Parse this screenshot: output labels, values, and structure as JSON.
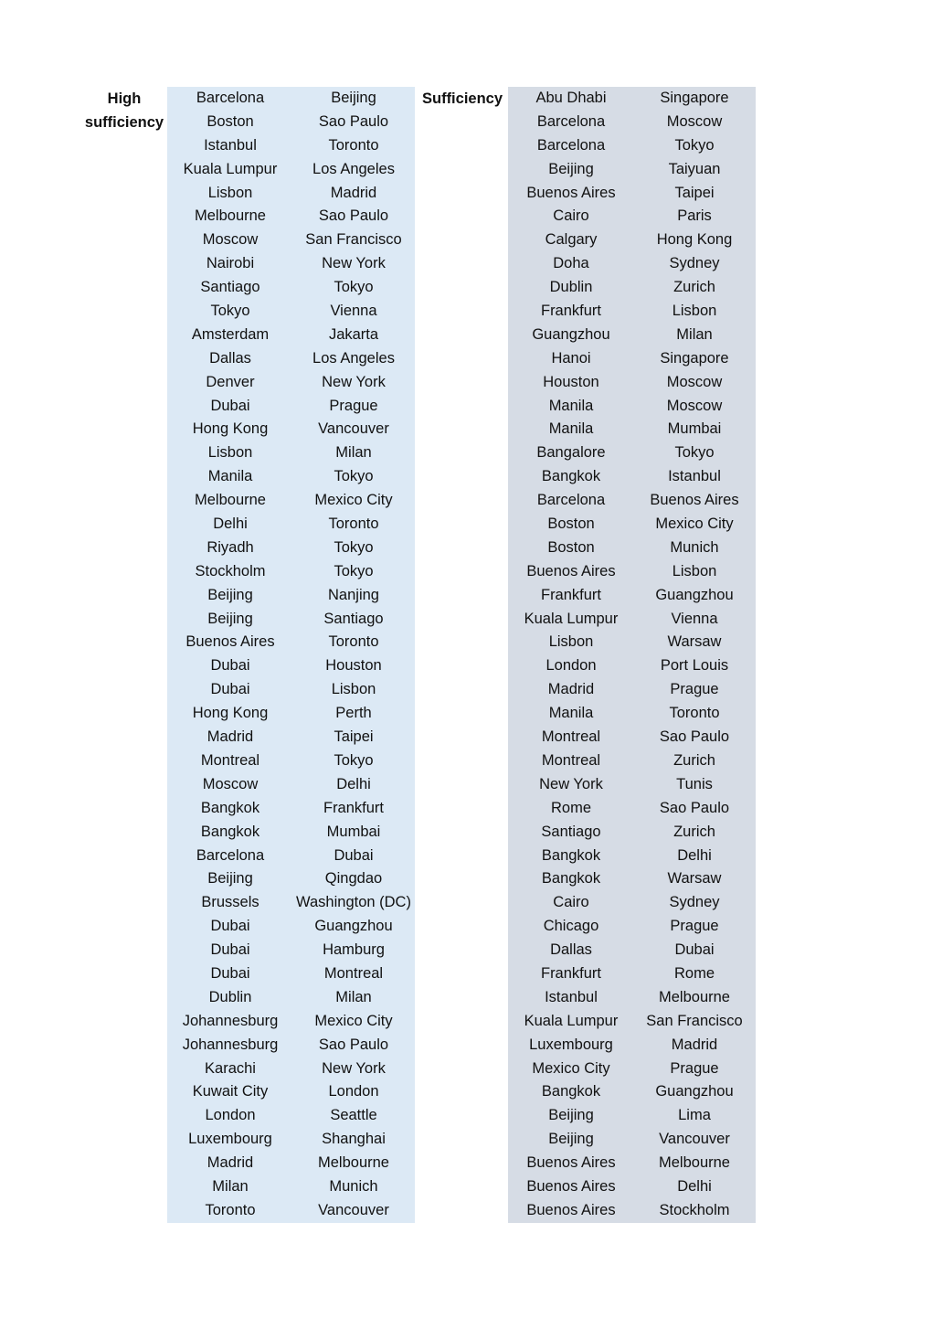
{
  "colors": {
    "high_sufficiency_fill": "#dce9f5",
    "sufficiency_fill": "#d6dce5"
  },
  "groups": {
    "high": {
      "label": "High sufficiency",
      "label_lines": [
        "High",
        "sufficiency"
      ],
      "rows": [
        [
          "Barcelona",
          "Beijing"
        ],
        [
          "Boston",
          "Sao Paulo"
        ],
        [
          "Istanbul",
          "Toronto"
        ],
        [
          "Kuala Lumpur",
          "Los Angeles"
        ],
        [
          "Lisbon",
          "Madrid"
        ],
        [
          "Melbourne",
          "Sao Paulo"
        ],
        [
          "Moscow",
          "San Francisco"
        ],
        [
          "Nairobi",
          "New York"
        ],
        [
          "Santiago",
          "Tokyo"
        ],
        [
          "Tokyo",
          "Vienna"
        ],
        [
          "Amsterdam",
          "Jakarta"
        ],
        [
          "Dallas",
          "Los Angeles"
        ],
        [
          "Denver",
          "New York"
        ],
        [
          "Dubai",
          "Prague"
        ],
        [
          "Hong Kong",
          "Vancouver"
        ],
        [
          "Lisbon",
          "Milan"
        ],
        [
          "Manila",
          "Tokyo"
        ],
        [
          "Melbourne",
          "Mexico City"
        ],
        [
          "Delhi",
          "Toronto"
        ],
        [
          "Riyadh",
          "Tokyo"
        ],
        [
          "Stockholm",
          "Tokyo"
        ],
        [
          "Beijing",
          "Nanjing"
        ],
        [
          "Beijing",
          "Santiago"
        ],
        [
          "Buenos Aires",
          "Toronto"
        ],
        [
          "Dubai",
          "Houston"
        ],
        [
          "Dubai",
          "Lisbon"
        ],
        [
          "Hong Kong",
          "Perth"
        ],
        [
          "Madrid",
          "Taipei"
        ],
        [
          "Montreal",
          "Tokyo"
        ],
        [
          "Moscow",
          "Delhi"
        ],
        [
          "Bangkok",
          "Frankfurt"
        ],
        [
          "Bangkok",
          "Mumbai"
        ],
        [
          "Barcelona",
          "Dubai"
        ],
        [
          "Beijing",
          "Qingdao"
        ],
        [
          "Brussels",
          "Washington (DC)"
        ],
        [
          "Dubai",
          "Guangzhou"
        ],
        [
          "Dubai",
          "Hamburg"
        ],
        [
          "Dubai",
          "Montreal"
        ],
        [
          "Dublin",
          "Milan"
        ],
        [
          "Johannesburg",
          "Mexico City"
        ],
        [
          "Johannesburg",
          "Sao Paulo"
        ],
        [
          "Karachi",
          "New York"
        ],
        [
          "Kuwait City",
          "London"
        ],
        [
          "London",
          "Seattle"
        ],
        [
          "Luxembourg",
          "Shanghai"
        ],
        [
          "Madrid",
          "Melbourne"
        ],
        [
          "Milan",
          "Munich"
        ],
        [
          "Toronto",
          "Vancouver"
        ]
      ]
    },
    "sufficiency": {
      "label": "Sufficiency",
      "label_lines": [
        "Sufficiency"
      ],
      "rows": [
        [
          "Abu Dhabi",
          "Singapore"
        ],
        [
          "Barcelona",
          "Moscow"
        ],
        [
          "Barcelona",
          "Tokyo"
        ],
        [
          "Beijing",
          "Taiyuan"
        ],
        [
          "Buenos Aires",
          "Taipei"
        ],
        [
          "Cairo",
          "Paris"
        ],
        [
          "Calgary",
          "Hong Kong"
        ],
        [
          "Doha",
          "Sydney"
        ],
        [
          "Dublin",
          "Zurich"
        ],
        [
          "Frankfurt",
          "Lisbon"
        ],
        [
          "Guangzhou",
          "Milan"
        ],
        [
          "Hanoi",
          "Singapore"
        ],
        [
          "Houston",
          "Moscow"
        ],
        [
          "Manila",
          "Moscow"
        ],
        [
          "Manila",
          "Mumbai"
        ],
        [
          "Bangalore",
          "Tokyo"
        ],
        [
          "Bangkok",
          "Istanbul"
        ],
        [
          "Barcelona",
          "Buenos Aires"
        ],
        [
          "Boston",
          "Mexico City"
        ],
        [
          "Boston",
          "Munich"
        ],
        [
          "Buenos Aires",
          "Lisbon"
        ],
        [
          "Frankfurt",
          "Guangzhou"
        ],
        [
          "Kuala Lumpur",
          "Vienna"
        ],
        [
          "Lisbon",
          "Warsaw"
        ],
        [
          "London",
          "Port Louis"
        ],
        [
          "Madrid",
          "Prague"
        ],
        [
          "Manila",
          "Toronto"
        ],
        [
          "Montreal",
          "Sao Paulo"
        ],
        [
          "Montreal",
          "Zurich"
        ],
        [
          "New York",
          "Tunis"
        ],
        [
          "Rome",
          "Sao Paulo"
        ],
        [
          "Santiago",
          "Zurich"
        ],
        [
          "Bangkok",
          "Delhi"
        ],
        [
          "Bangkok",
          "Warsaw"
        ],
        [
          "Cairo",
          "Sydney"
        ],
        [
          "Chicago",
          "Prague"
        ],
        [
          "Dallas",
          "Dubai"
        ],
        [
          "Frankfurt",
          "Rome"
        ],
        [
          "Istanbul",
          "Melbourne"
        ],
        [
          "Kuala Lumpur",
          "San Francisco"
        ],
        [
          "Luxembourg",
          "Madrid"
        ],
        [
          "Mexico City",
          "Prague"
        ],
        [
          "Bangkok",
          "Guangzhou"
        ],
        [
          "Beijing",
          "Lima"
        ],
        [
          "Beijing",
          "Vancouver"
        ],
        [
          "Buenos Aires",
          "Melbourne"
        ],
        [
          "Buenos Aires",
          "Delhi"
        ],
        [
          "Buenos Aires",
          "Stockholm"
        ]
      ]
    }
  }
}
